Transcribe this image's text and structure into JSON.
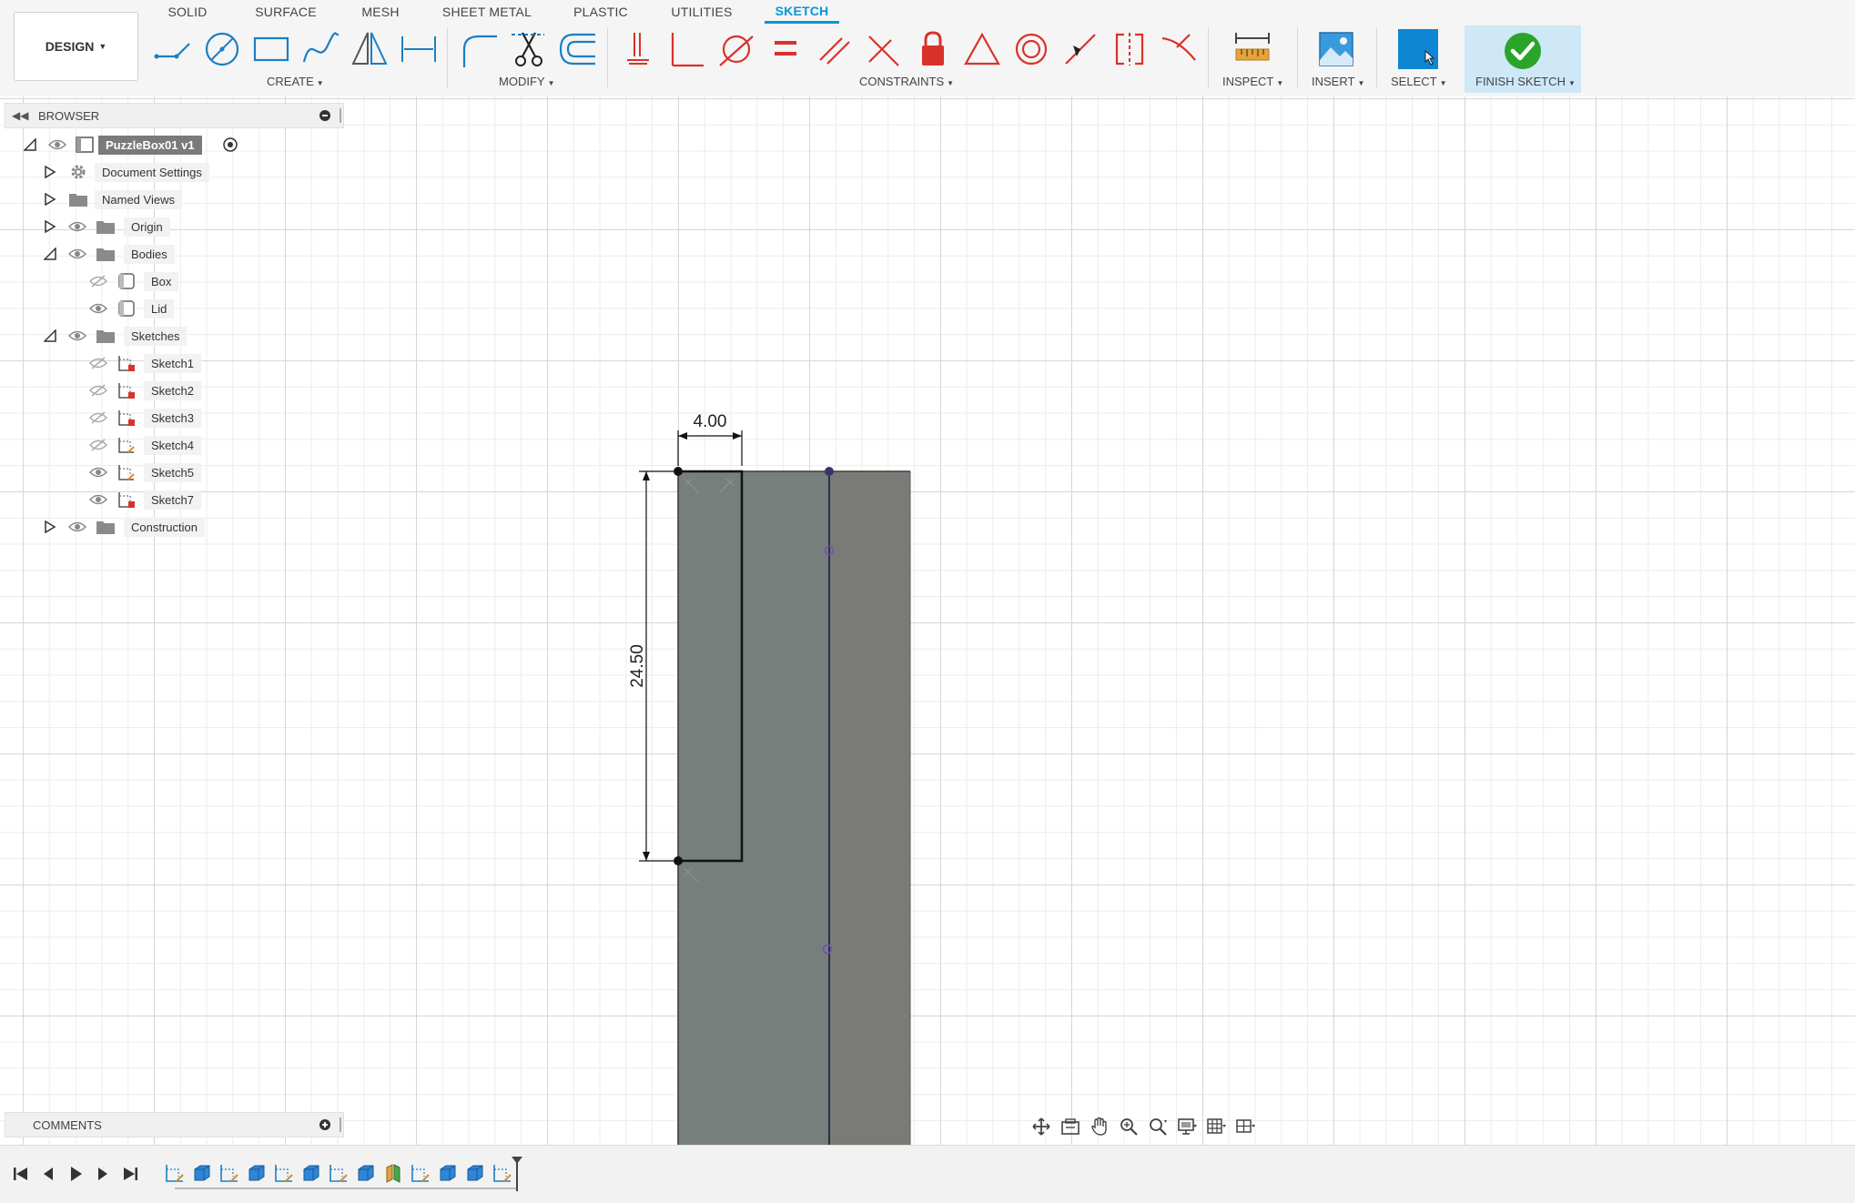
{
  "workspace": {
    "label": "DESIGN"
  },
  "tabs": [
    {
      "label": "SOLID"
    },
    {
      "label": "SURFACE"
    },
    {
      "label": "MESH"
    },
    {
      "label": "SHEET METAL"
    },
    {
      "label": "PLASTIC"
    },
    {
      "label": "UTILITIES"
    },
    {
      "label": "SKETCH"
    }
  ],
  "active_tab": "SKETCH",
  "groups": {
    "create": "CREATE",
    "modify": "MODIFY",
    "constraints": "CONSTRAINTS",
    "inspect": "INSPECT",
    "insert": "INSERT",
    "select": "SELECT",
    "finish": "FINISH SKETCH"
  },
  "icons": {
    "create": [
      "line-icon",
      "circle-icon",
      "rectangle-icon",
      "spline-icon",
      "mirror-icon",
      "sketch-dimension-icon"
    ],
    "modify": [
      "fillet-icon",
      "trim-icon",
      "offset-icon"
    ],
    "constraints": [
      "coincident-icon",
      "collinear-icon",
      "tangent-icon",
      "equal-icon",
      "parallel-icon",
      "perpendicular-icon",
      "fix-icon",
      "triangle-icon",
      "concentric-icon",
      "midpoint-icon",
      "symmetry-icon",
      "curvature-icon"
    ]
  },
  "colors": {
    "accent": "#0696d7",
    "finish_bg": "#cfe8f7",
    "finish_check": "#2aa52a",
    "constraint_red": "#d9322b",
    "body_gray": "#7b7e7b",
    "profile_gray": "#767f7c"
  },
  "browser": {
    "title": "BROWSER",
    "root": "PuzzleBox01 v1",
    "items": [
      {
        "label": "Document Settings"
      },
      {
        "label": "Named Views"
      },
      {
        "label": "Origin"
      },
      {
        "label": "Bodies"
      },
      {
        "label": "Box"
      },
      {
        "label": "Lid"
      },
      {
        "label": "Sketches"
      },
      {
        "label": "Sketch1"
      },
      {
        "label": "Sketch2"
      },
      {
        "label": "Sketch3"
      },
      {
        "label": "Sketch4"
      },
      {
        "label": "Sketch5"
      },
      {
        "label": "Sketch7"
      },
      {
        "label": "Construction"
      }
    ]
  },
  "sketch": {
    "dim_width": "4.00",
    "dim_height": "24.50"
  },
  "comments": {
    "title": "COMMENTS"
  },
  "timeline": {
    "items": [
      "sketch-icon",
      "extrude-icon",
      "sketch-icon",
      "extrude-icon",
      "sketch-icon",
      "extrude-icon",
      "sketch-icon",
      "extrude-icon",
      "split-icon",
      "sketch-icon",
      "extrude-icon",
      "extrude-icon",
      "sketch-icon"
    ]
  }
}
